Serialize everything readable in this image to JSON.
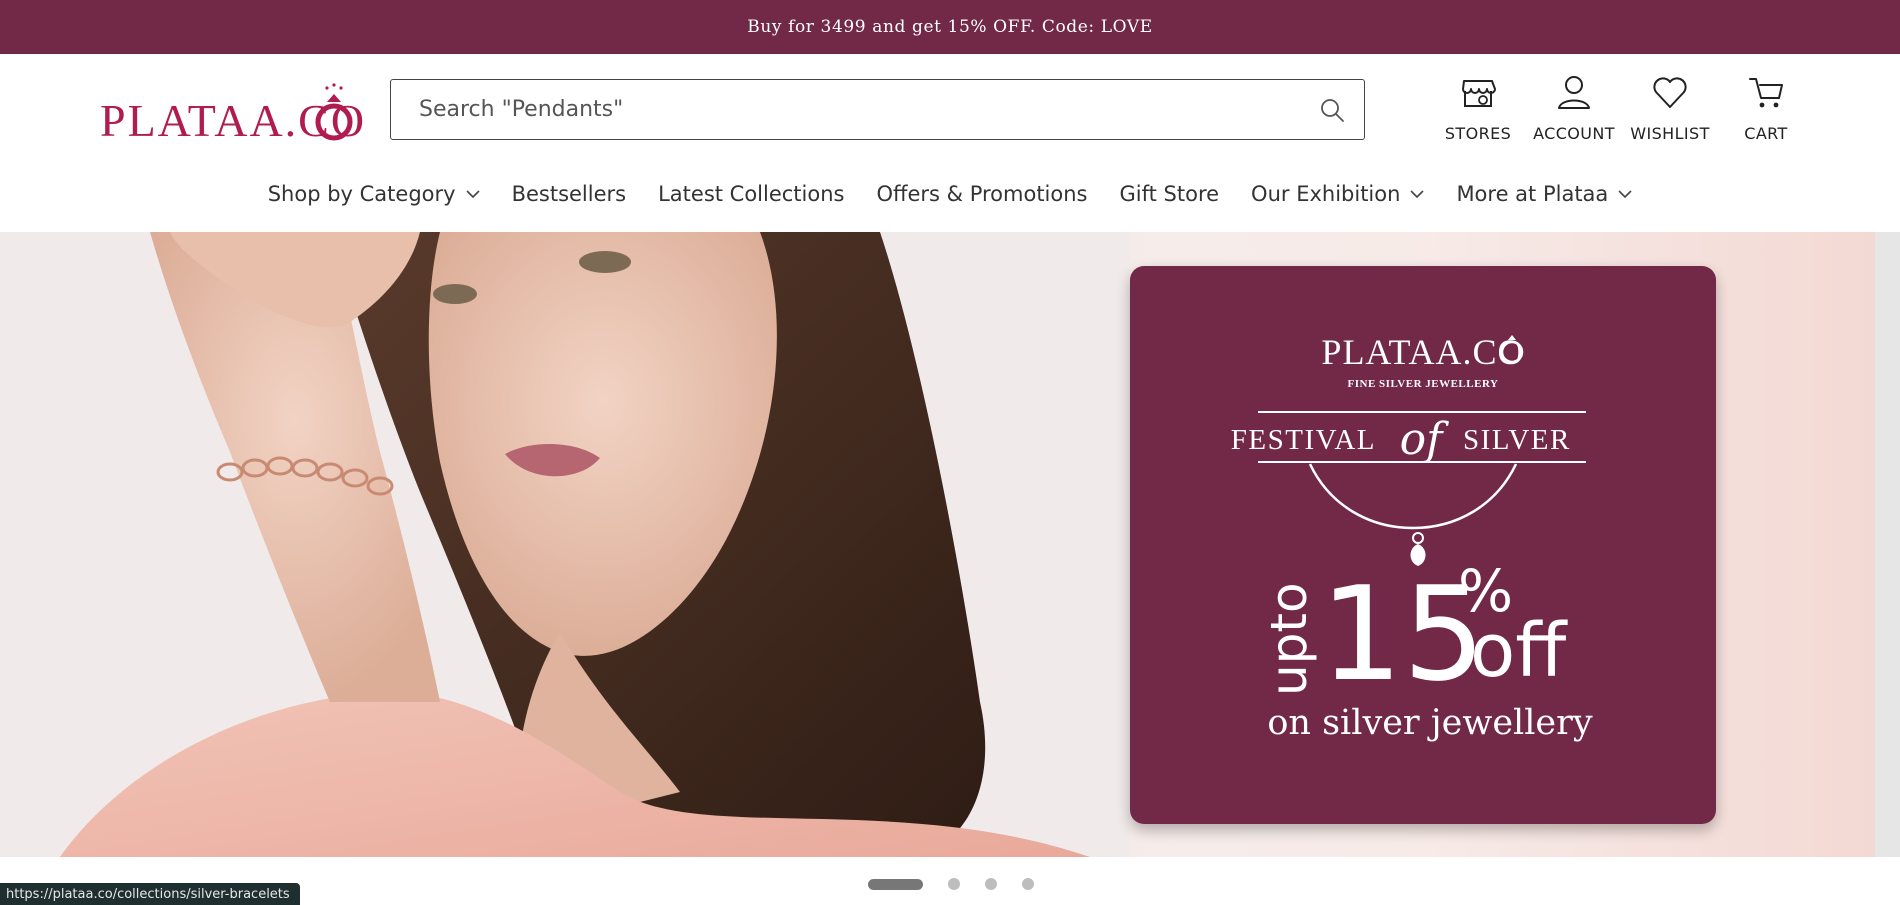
{
  "announcement": "Buy for 3499 and get 15% OFF. Code: LOVE",
  "brand": {
    "name": "PLATAA.CO",
    "color": "#b01c4f",
    "accent": "#722947"
  },
  "search": {
    "placeholder": "Search \"Pendants\""
  },
  "header_icons": [
    {
      "label": "STORES",
      "icon": "store-icon"
    },
    {
      "label": "ACCOUNT",
      "icon": "user-icon"
    },
    {
      "label": "WISHLIST",
      "icon": "heart-icon"
    },
    {
      "label": "CART",
      "icon": "cart-icon"
    }
  ],
  "nav": [
    {
      "label": "Shop by Category",
      "dropdown": true
    },
    {
      "label": "Bestsellers",
      "dropdown": false
    },
    {
      "label": "Latest Collections",
      "dropdown": false
    },
    {
      "label": "Offers & Promotions",
      "dropdown": false
    },
    {
      "label": "Gift Store",
      "dropdown": false
    },
    {
      "label": "Our Exhibition",
      "dropdown": true
    },
    {
      "label": "More at Plataa",
      "dropdown": true
    }
  ],
  "hero": {
    "brand": "PLATAA.CO",
    "tagline": "FINE SILVER JEWELLERY",
    "festival_left": "FESTIVAL",
    "festival_of": "of",
    "festival_right": "SILVER",
    "offer_prefix": "upto",
    "offer_number": "15",
    "offer_percent": "%",
    "offer_off": "off",
    "offer_sub": "on silver jewellery"
  },
  "carousel": {
    "total": 4,
    "active": 0
  },
  "status_url": "https://plataa.co/collections/silver-bracelets"
}
